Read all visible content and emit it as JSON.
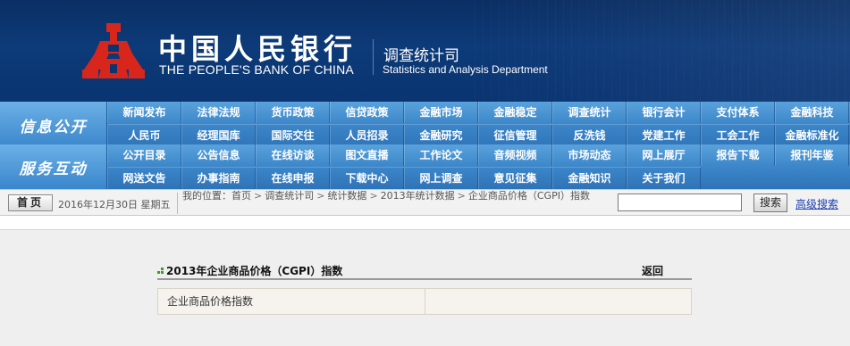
{
  "header": {
    "brand_cn": "中国人民银行",
    "brand_en": "THE PEOPLE'S BANK OF CHINA",
    "dept_cn": "调查统计司",
    "dept_en": "Statistics and Analysis Department",
    "logo_color": "#d8261c"
  },
  "nav": {
    "info_title": "信息公开",
    "info_row1": [
      "新闻发布",
      "法律法规",
      "货币政策",
      "信贷政策",
      "金融市场",
      "金融稳定",
      "调查统计",
      "银行会计",
      "支付体系",
      "金融科技"
    ],
    "info_row2": [
      "人民币",
      "经理国库",
      "国际交往",
      "人员招录",
      "金融研究",
      "征信管理",
      "反洗钱",
      "党建工作",
      "工会工作",
      "金融标准化"
    ],
    "service_title": "服务互动",
    "service_row1": [
      "公开目录",
      "公告信息",
      "在线访谈",
      "图文直播",
      "工作论文",
      "音频视频",
      "市场动态",
      "网上展厅",
      "报告下载",
      "报刊年鉴"
    ],
    "service_row2": [
      "网送文告",
      "办事指南",
      "在线申报",
      "下载中心",
      "网上调查",
      "意见征集",
      "金融知识",
      "关于我们"
    ]
  },
  "util": {
    "home_label": "首页",
    "date": "2016年12月30日 星期五",
    "crumb_prefix": "我的位置：",
    "crumbs": [
      "首页",
      "调查统计司",
      "统计数据",
      "2013年统计数据",
      "企业商品价格（CGPI）指数"
    ],
    "search_value": "",
    "search_button": "搜索",
    "advanced_search": "高级搜索"
  },
  "content": {
    "title": "2013年企业商品价格（CGPI）指数",
    "back_label": "返回",
    "rows": [
      {
        "name": "企业商品价格指数",
        "value": ""
      }
    ],
    "accent_color": "#3f9a26"
  }
}
